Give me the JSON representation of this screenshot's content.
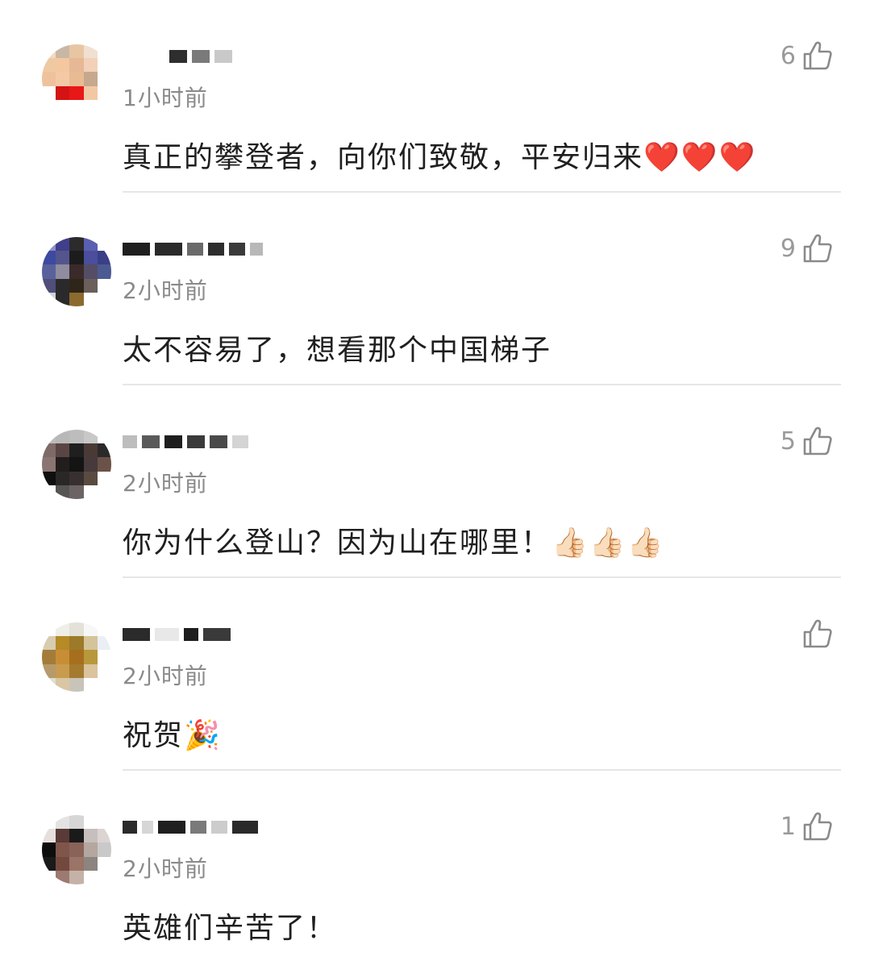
{
  "comments": [
    {
      "timestamp": "1小时前",
      "content": "真正的攀登者，向你们致敬，平安归来❤️❤️❤️",
      "likes": "6",
      "avatar_colors": [
        "#f5d9c0",
        "#c9b7a6",
        "#e8c6a4",
        "#f0e0d2",
        "#ffffff",
        "#efc9a2",
        "#f3c7a0",
        "#e6b896",
        "#f2d1b8",
        "#ffffff",
        "#eec29c",
        "#f4caa6",
        "#e9bb92",
        "#c6a88e",
        "#ffffff",
        "#ffffff",
        "#d41414",
        "#e81818",
        "#f2c8a4",
        "#ffffff",
        "#ffffff",
        "#ffffff",
        "#ffffff",
        "#ffffff",
        "#ffffff"
      ]
    },
    {
      "timestamp": "2小时前",
      "content": "太不容易了，想看那个中国梯子",
      "likes": "9",
      "avatar_colors": [
        "#8d8fc4",
        "#3f3f8c",
        "#2b2b2b",
        "#5a5fb2",
        "#ffffff",
        "#3c4aa0",
        "#55558e",
        "#1c1c1c",
        "#4a4e9c",
        "#3a3f86",
        "#59619c",
        "#8e8c9e",
        "#3a2a2a",
        "#554d65",
        "#4b5a92",
        "#4f4f7a",
        "#2a2a2a",
        "#2f2519",
        "#6a5f5a",
        "#ffffff",
        "#d2d2d2",
        "#2a2a2a",
        "#8b6a30",
        "#ffffff",
        "#ffffff"
      ]
    },
    {
      "timestamp": "2小时前",
      "content": "你为什么登山？因为山在哪里！👍🏻👍🏻👍🏻",
      "likes": "5",
      "avatar_colors": [
        "#bcbcbc",
        "#b8b8b8",
        "#bdbdbd",
        "#c8c8c8",
        "#ffffff",
        "#7f6a66",
        "#5a4544",
        "#1f1f1f",
        "#4a3a36",
        "#2a2a2a",
        "#8a7573",
        "#231e1e",
        "#141414",
        "#463a3a",
        "#6a5248",
        "#0f0f0f",
        "#2a2727",
        "#383030",
        "#5a4a40",
        "#ffffff",
        "#ffffff",
        "#585454",
        "#6c6464",
        "#ffffff",
        "#ffffff"
      ]
    },
    {
      "timestamp": "2小时前",
      "content": "祝贺🎉",
      "likes": "",
      "avatar_colors": [
        "#ffffff",
        "#f0eee8",
        "#e4e1d8",
        "#f7f7f7",
        "#ffffff",
        "#d8ccb0",
        "#b58a27",
        "#9c7a2a",
        "#d5c49a",
        "#eaeff6",
        "#a47c3a",
        "#c78e36",
        "#a66f1e",
        "#b8983c",
        "#ffffff",
        "#b79a6a",
        "#c89b4f",
        "#a47b2e",
        "#dbc39e",
        "#ffffff",
        "#e3dcd0",
        "#d8c6a4",
        "#c9c4ba",
        "#ffffff",
        "#ffffff"
      ]
    },
    {
      "timestamp": "2小时前",
      "content": "英雄们辛苦了！",
      "likes": "1",
      "avatar_colors": [
        "#ffffff",
        "#e3e3e3",
        "#d6d6d6",
        "#ffffff",
        "#ffffff",
        "#e7dfdb",
        "#5a3a36",
        "#1a1a1a",
        "#c7bfbd",
        "#dcd4d2",
        "#0d0d0d",
        "#80554a",
        "#8a6358",
        "#b6a6a0",
        "#c9c9c9",
        "#1a1a1a",
        "#73493f",
        "#9a7466",
        "#8c857f",
        "#ffffff",
        "#ffffff",
        "#9c7a72",
        "#c4b2a8",
        "#ffffff",
        "#ffffff"
      ]
    }
  ]
}
